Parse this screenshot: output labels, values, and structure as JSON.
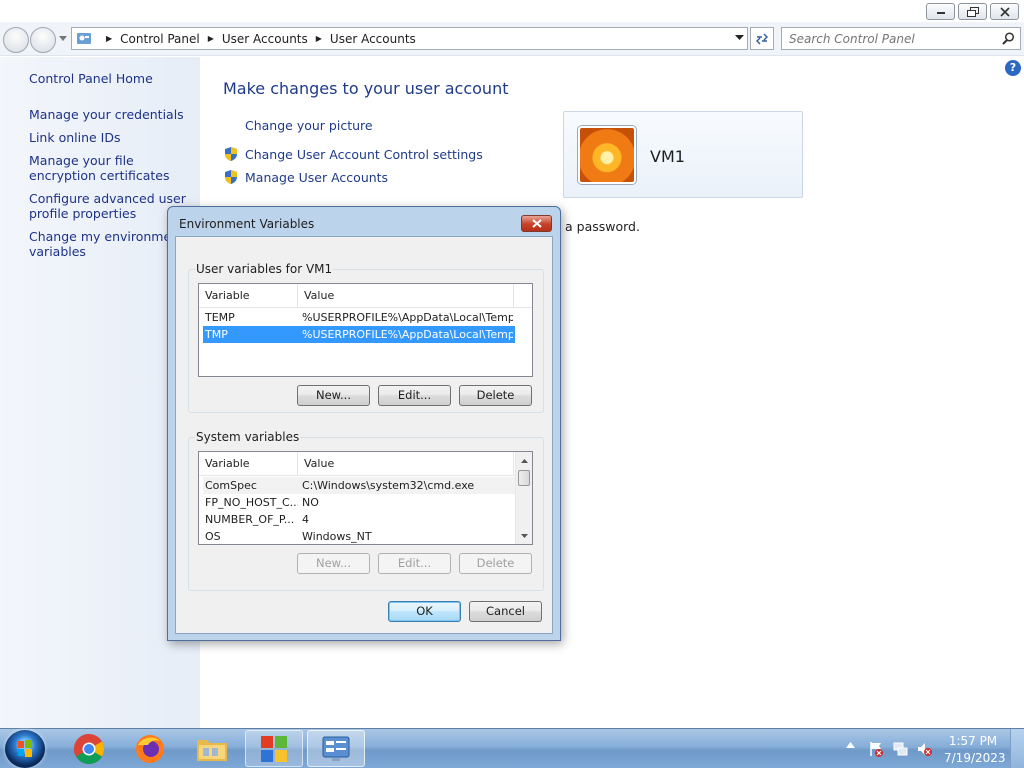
{
  "window": {
    "breadcrumb": [
      "Control Panel",
      "User Accounts",
      "User Accounts"
    ],
    "search_placeholder": "Search Control Panel"
  },
  "sidebar": {
    "home": "Control Panel Home",
    "items": [
      "Manage your credentials",
      "Link online IDs",
      "Manage your file encryption certificates",
      "Configure advanced user profile properties",
      "Change my environment variables"
    ]
  },
  "main": {
    "title": "Make changes to your user account",
    "tasks": {
      "picture": "Change your picture",
      "uac": "Change User Account Control settings",
      "manage": "Manage User Accounts"
    },
    "account_name": "VM1",
    "password_fragment": "a password."
  },
  "dialog": {
    "title": "Environment Variables",
    "user_group_label": "User variables for VM1",
    "system_group_label": "System variables",
    "columns": [
      "Variable",
      "Value"
    ],
    "user_vars": [
      {
        "name": "TEMP",
        "value": "%USERPROFILE%\\AppData\\Local\\Temp"
      },
      {
        "name": "TMP",
        "value": "%USERPROFILE%\\AppData\\Local\\Temp",
        "selected": true
      }
    ],
    "system_vars": [
      {
        "name": "ComSpec",
        "value": "C:\\Windows\\system32\\cmd.exe"
      },
      {
        "name": "FP_NO_HOST_C...",
        "value": "NO"
      },
      {
        "name": "NUMBER_OF_P...",
        "value": "4"
      },
      {
        "name": "OS",
        "value": "Windows_NT"
      }
    ],
    "buttons": {
      "new": "New...",
      "edit": "Edit...",
      "delete": "Delete",
      "ok": "OK",
      "cancel": "Cancel"
    }
  },
  "taskbar": {
    "apps": [
      "chrome-icon",
      "firefox-icon",
      "file-explorer-icon",
      "windows-flag-icon",
      "control-panel-icon"
    ],
    "time": "1:57 PM",
    "date": "7/19/2023"
  },
  "colors": {
    "link": "#1e3287",
    "selection": "#3399ff",
    "taskbar": "#86aed8",
    "dialog_frame": "#bcd3ec"
  }
}
